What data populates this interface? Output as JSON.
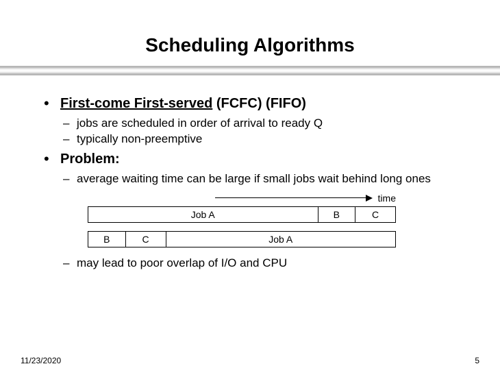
{
  "title": "Scheduling Algorithms",
  "bullets": {
    "b1": {
      "label_underlined": "First-come First-served",
      "label_rest": " (FCFC) (FIFO)",
      "sub": [
        "jobs are scheduled in order of arrival to ready Q",
        "typically non-preemptive"
      ]
    },
    "b2": {
      "label": "Problem:",
      "sub_before": "average waiting time can be large if small jobs wait behind long ones",
      "sub_after": "may lead to poor overlap of I/O and CPU"
    }
  },
  "diagram": {
    "time_label": "time",
    "bar1": [
      {
        "label": "Job A",
        "flex": 7.5
      },
      {
        "label": "B",
        "flex": 1.2
      },
      {
        "label": "C",
        "flex": 1.3
      }
    ],
    "bar2": [
      {
        "label": "B",
        "flex": 1.2
      },
      {
        "label": "C",
        "flex": 1.3
      },
      {
        "label": "Job A",
        "flex": 7.5
      }
    ]
  },
  "footer": {
    "date": "11/23/2020",
    "page": "5"
  }
}
